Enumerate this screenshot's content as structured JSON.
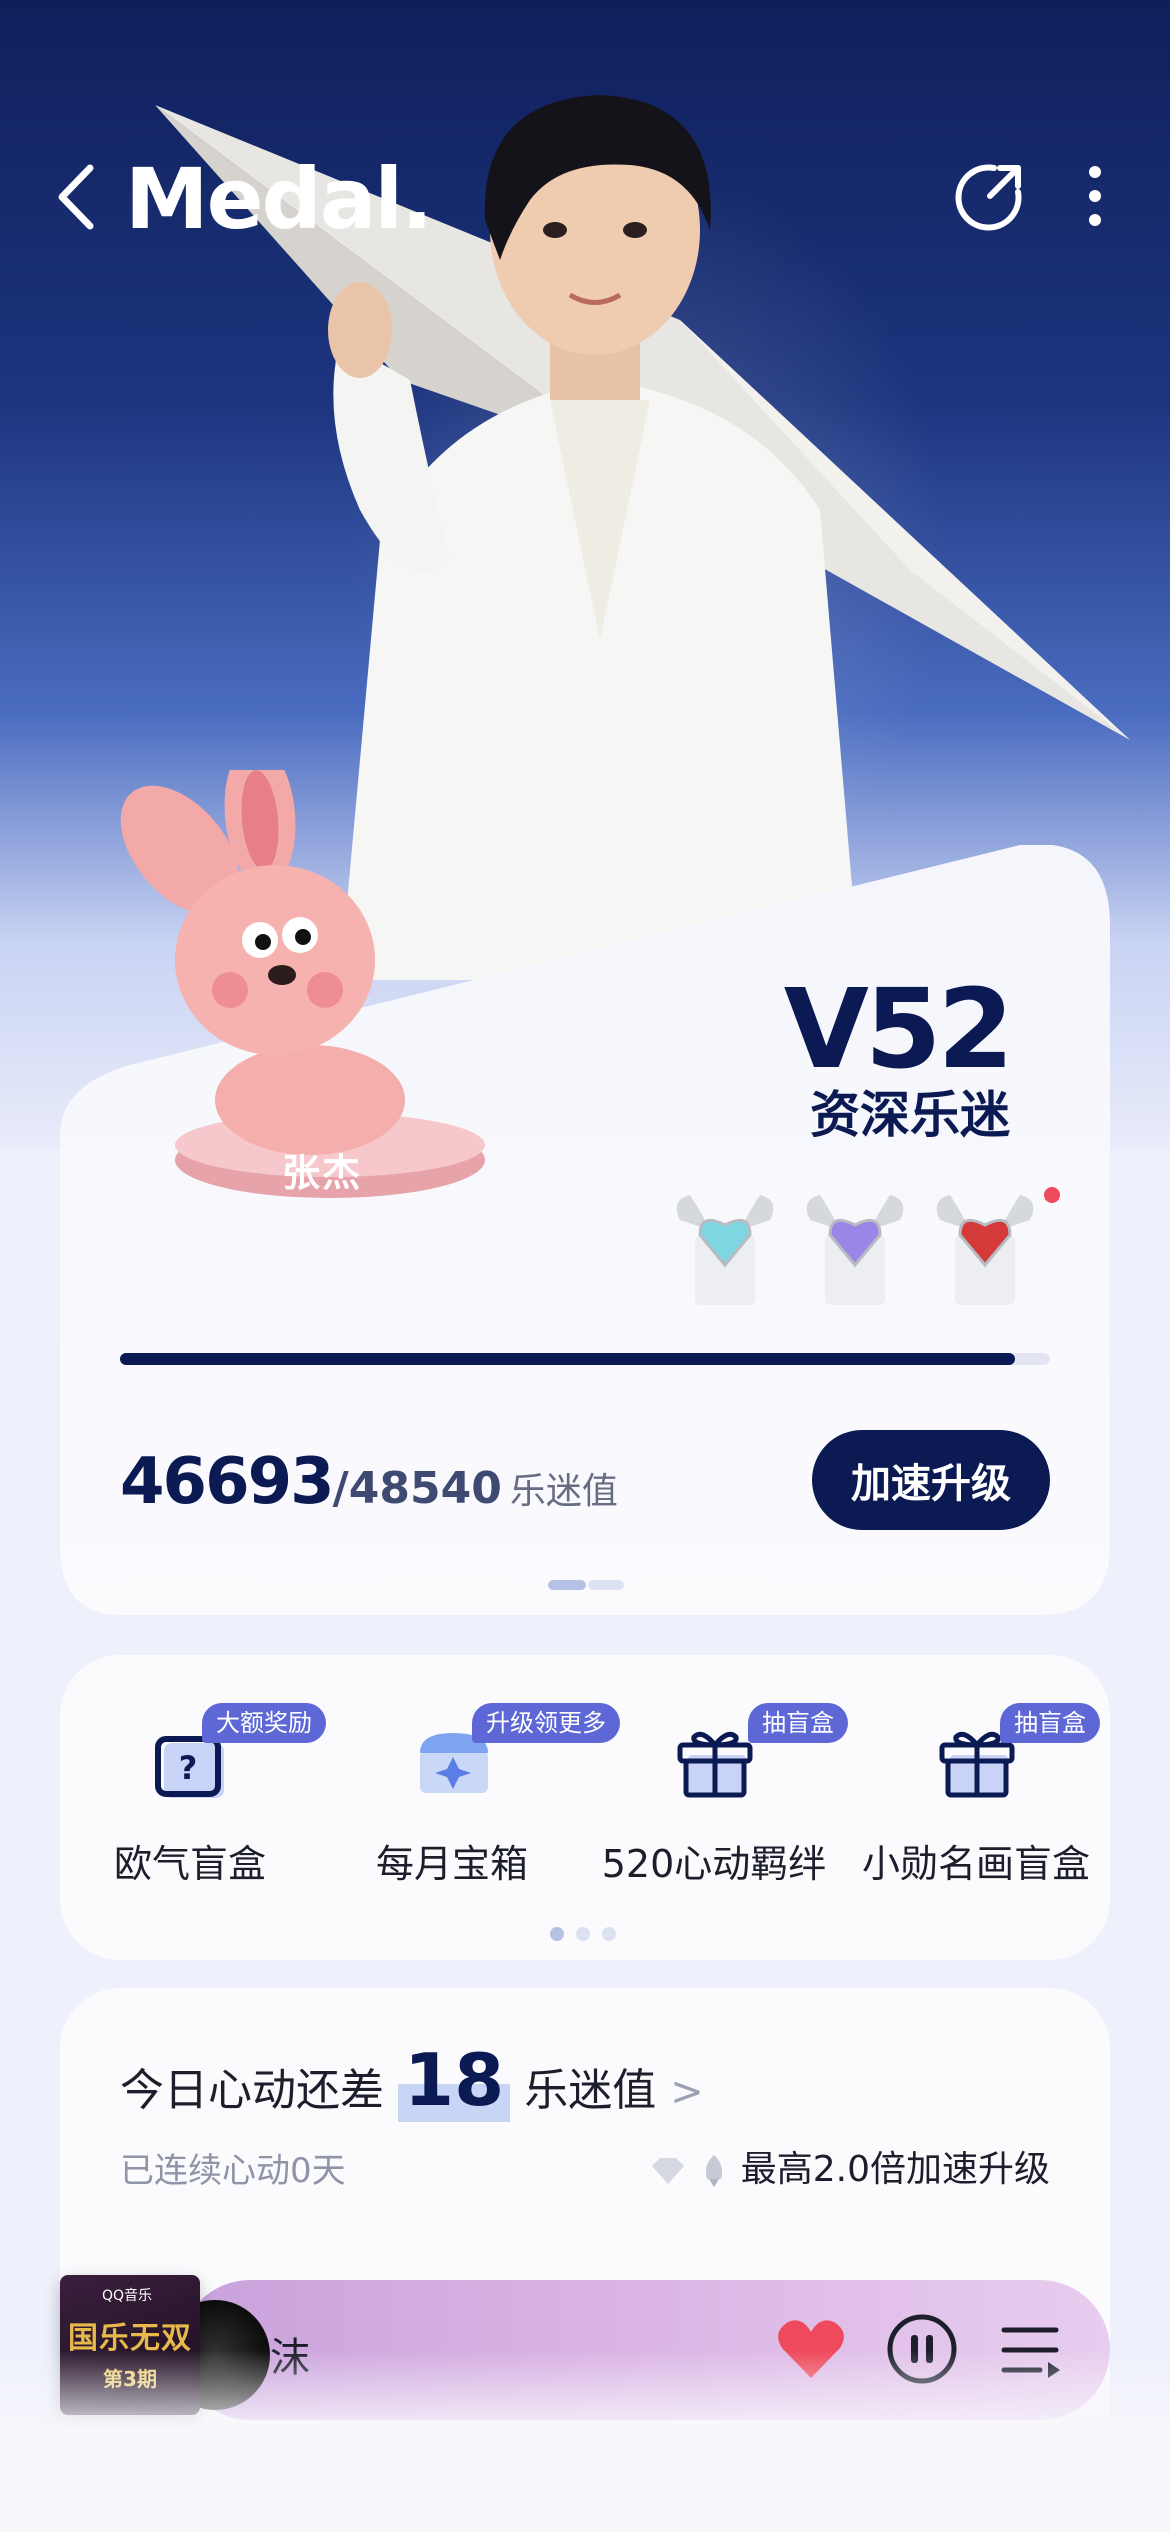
{
  "header": {
    "title": "Medal.",
    "back_icon": "chevron-left-icon",
    "share_icon": "share-icon",
    "more_icon": "more-vertical-icon"
  },
  "level_card": {
    "level": "V52",
    "level_title": "资深乐迷",
    "current_points": "46693",
    "target_points": "/48540",
    "points_unit": "乐迷值",
    "progress": 0.962,
    "upgrade_button": "加速升级",
    "mascot_label": "张杰",
    "badges": [
      "winged-heart-teal-badge",
      "winged-heart-purple-badge",
      "winged-heart-red-badge"
    ]
  },
  "features": [
    {
      "label": "欧气盲盒",
      "tag": "大额奖励",
      "icon": "mystery-box-icon"
    },
    {
      "label": "每月宝箱",
      "tag": "升级领更多",
      "icon": "treasure-chest-icon"
    },
    {
      "label": "520心动羁绊",
      "tag": "抽盲盒",
      "icon": "gift-box-icon"
    },
    {
      "label": "小勋名画盲盒",
      "tag": "抽盲盒",
      "icon": "gift-box-icon"
    }
  ],
  "heart": {
    "prefix": "今日心动还差",
    "number": "18",
    "unit": "乐迷值",
    "chevron": ">",
    "streak": "已连续心动0天",
    "boost": "最高2.0倍加速升级"
  },
  "player": {
    "song": "沫",
    "album_logo": "QQ音乐",
    "album_title": "国乐无双",
    "album_episode": "第3期"
  },
  "colors": {
    "navy": "#0b1a52",
    "tag_blue": "#5d68d6",
    "heart_red": "#ef4a5c"
  }
}
